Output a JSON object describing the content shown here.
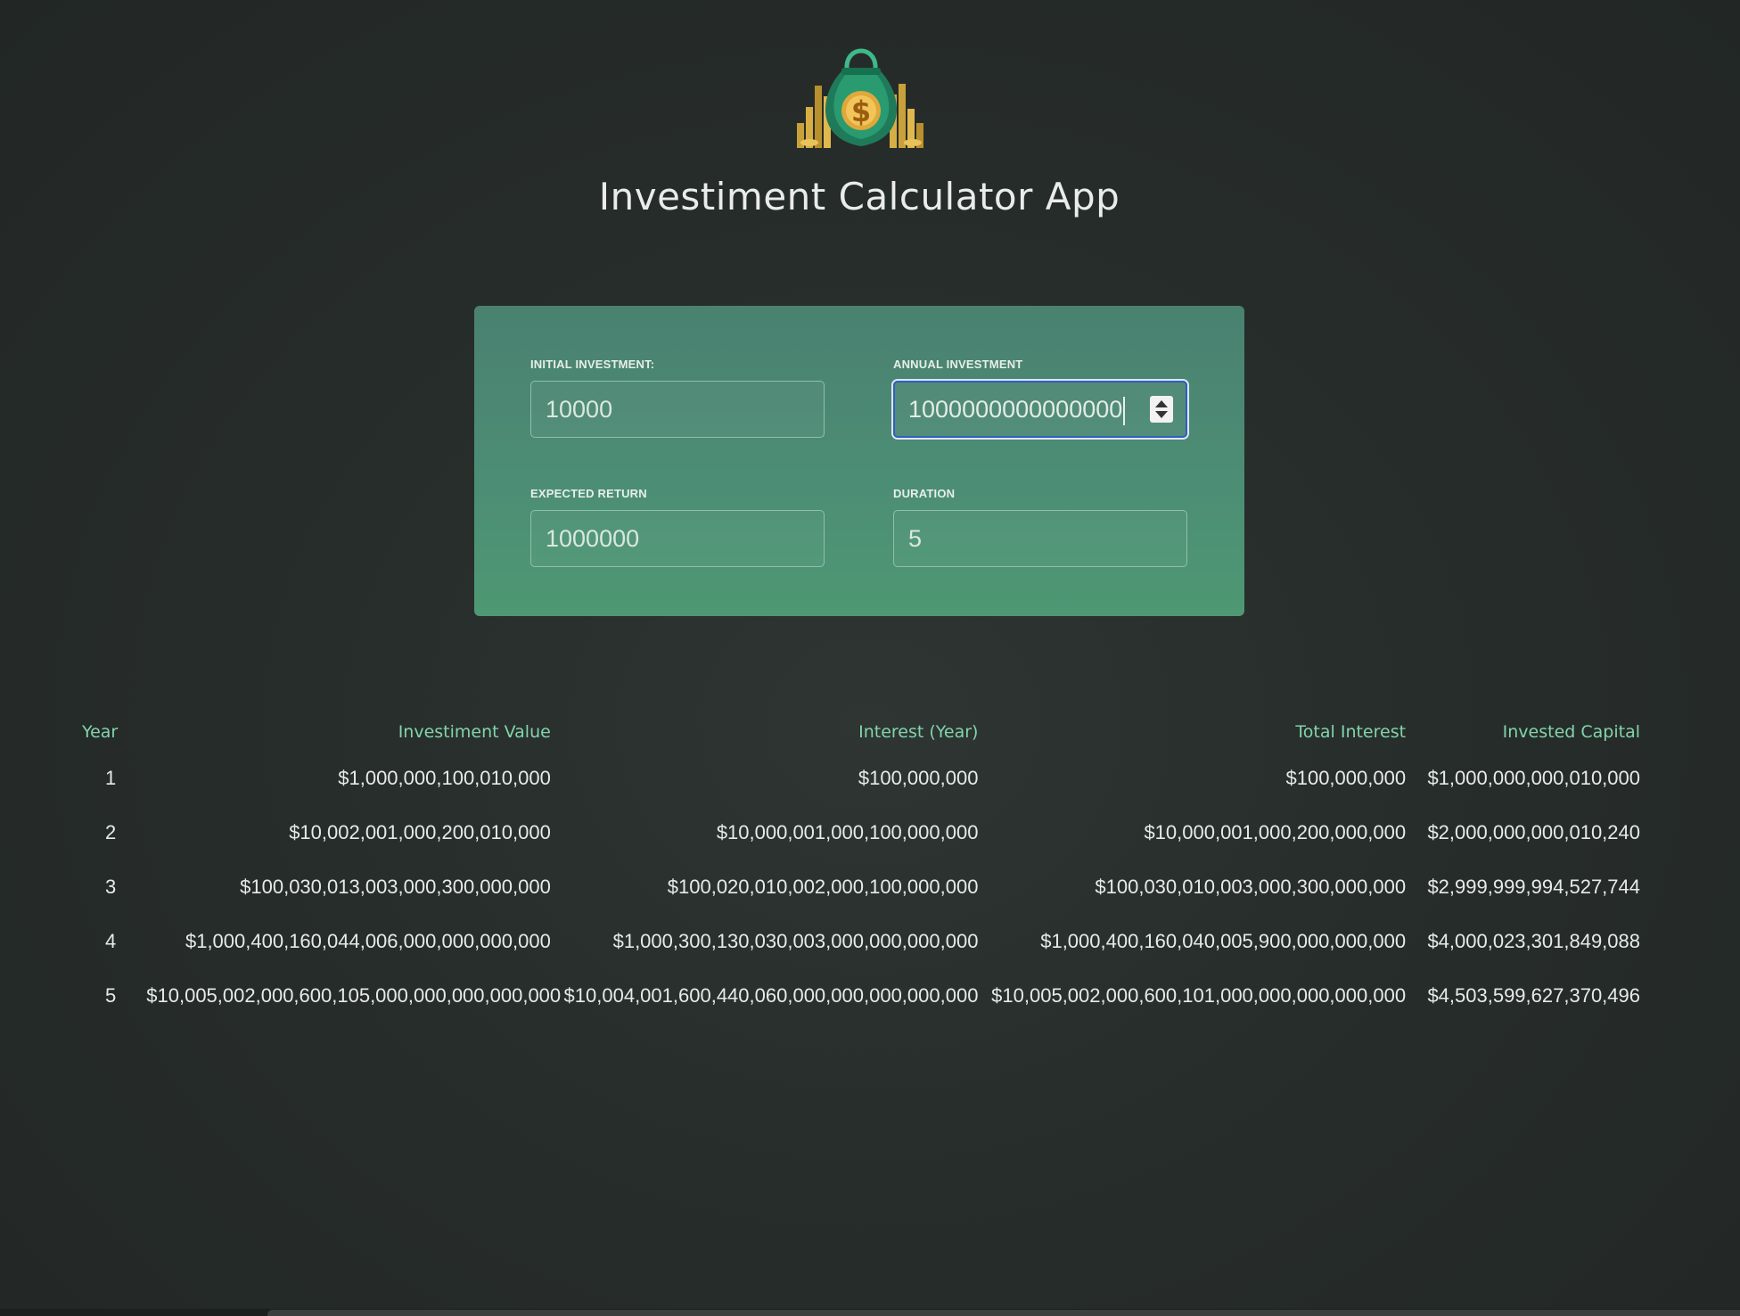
{
  "app": {
    "title": "Investiment Calculator App",
    "logo_icon": "money-bag-icon"
  },
  "inputs": {
    "initial_investment": {
      "label": "INITIAL INVESTMENT:",
      "value": "10000"
    },
    "annual_investment": {
      "label": "ANNUAL INVESTMENT",
      "value": "1000000000000000"
    },
    "expected_return": {
      "label": "EXPECTED RETURN",
      "value": "1000000"
    },
    "duration": {
      "label": "DURATION",
      "value": "5"
    }
  },
  "table": {
    "headers": {
      "year": "Year",
      "investment_value": "Investiment Value",
      "interest_year": "Interest (Year)",
      "total_interest": "Total Interest",
      "invested_capital": "Invested Capital"
    },
    "rows": [
      {
        "year": "1",
        "investment_value": "$1,000,000,100,010,000",
        "interest_year": "$100,000,000",
        "total_interest": "$100,000,000",
        "invested_capital": "$1,000,000,000,010,000"
      },
      {
        "year": "2",
        "investment_value": "$10,002,001,000,200,010,000",
        "interest_year": "$10,000,001,000,100,000,000",
        "total_interest": "$10,000,001,000,200,000,000",
        "invested_capital": "$2,000,000,000,010,240"
      },
      {
        "year": "3",
        "investment_value": "$100,030,013,003,000,300,000,000",
        "interest_year": "$100,020,010,002,000,100,000,000",
        "total_interest": "$100,030,010,003,000,300,000,000",
        "invested_capital": "$2,999,999,994,527,744"
      },
      {
        "year": "4",
        "investment_value": "$1,000,400,160,044,006,000,000,000,000",
        "interest_year": "$1,000,300,130,030,003,000,000,000,000",
        "total_interest": "$1,000,400,160,040,005,900,000,000,000",
        "invested_capital": "$4,000,023,301,849,088"
      },
      {
        "year": "5",
        "investment_value": "$10,005,002,000,600,105,000,000,000,000,000",
        "interest_year": "$10,004,001,600,440,060,000,000,000,000,000",
        "total_interest": "$10,005,002,000,600,101,000,000,000,000,000",
        "invested_capital": "$4,503,599,627,370,496"
      }
    ]
  },
  "colors": {
    "background": "#262c2a",
    "card_top": "#4a8170",
    "card_bottom": "#4e9873",
    "header_accent": "#83d4ab",
    "focus_ring": "#2f5fc4"
  }
}
